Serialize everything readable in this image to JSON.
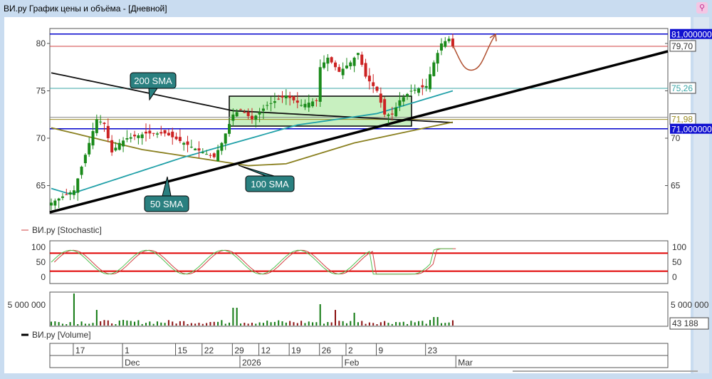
{
  "window": {
    "title": "ВИ.ру График цены и объёма - [Дневной]",
    "pin_icon": "pin-icon"
  },
  "price_panel": {
    "y_ticks": [
      "80",
      "75",
      "70",
      "65"
    ],
    "y_tick_values": [
      80,
      75,
      70,
      65
    ],
    "levels": [
      {
        "label": "81,000000",
        "value": 81,
        "color": "#0000cc",
        "style": "badge"
      },
      {
        "label": "79,70",
        "value": 79.7,
        "color": "#d04040",
        "style": "box"
      },
      {
        "label": "75,26",
        "value": 75.26,
        "color": "#3aa6a6",
        "style": "box"
      },
      {
        "label": "71,98",
        "value": 71.98,
        "color": "#9a8a20",
        "style": "box"
      },
      {
        "label": "71,000000",
        "value": 71,
        "color": "#0000cc",
        "style": "badge"
      }
    ],
    "annotations": [
      "200 SMA",
      "50 SMA",
      "100 SMA"
    ],
    "close_keypoints": [
      [
        0,
        63.2
      ],
      [
        6,
        64.5
      ],
      [
        8,
        67
      ],
      [
        10,
        69.5
      ],
      [
        12,
        72
      ],
      [
        14,
        71.5
      ],
      [
        16,
        68.5
      ],
      [
        18,
        69.5
      ],
      [
        20,
        70
      ],
      [
        25,
        70.5
      ],
      [
        30,
        70.5
      ],
      [
        35,
        69.5
      ],
      [
        40,
        68.5
      ],
      [
        43,
        68
      ],
      [
        45,
        69.5
      ],
      [
        48,
        72.5
      ],
      [
        50,
        73
      ],
      [
        53,
        72
      ],
      [
        57,
        73.5
      ],
      [
        62,
        74.5
      ],
      [
        66,
        73.5
      ],
      [
        70,
        74
      ],
      [
        71,
        77.5
      ],
      [
        73,
        78.5
      ],
      [
        76,
        77
      ],
      [
        79,
        78
      ],
      [
        81,
        79
      ],
      [
        83,
        76.5
      ],
      [
        86,
        75
      ],
      [
        88,
        72.5
      ],
      [
        90,
        72.5
      ],
      [
        92,
        74
      ],
      [
        95,
        75
      ],
      [
        99,
        75.5
      ],
      [
        101,
        78
      ],
      [
        103,
        80
      ],
      [
        105,
        80.5
      ],
      [
        106,
        79.7
      ]
    ],
    "sma200": [
      [
        0,
        76.9
      ],
      [
        48,
        72.9
      ],
      [
        106,
        71.65
      ]
    ],
    "sma50": [
      [
        0,
        64.7
      ],
      [
        5,
        64.1
      ],
      [
        35,
        68
      ],
      [
        65,
        71.4
      ],
      [
        86,
        72.6
      ],
      [
        106,
        75.0
      ]
    ],
    "sma100": [
      [
        0,
        71.1
      ],
      [
        24,
        68.8
      ],
      [
        52,
        67.1
      ],
      [
        62,
        67.3
      ],
      [
        80,
        69.5
      ],
      [
        106,
        71.7
      ]
    ]
  },
  "stochastic": {
    "legend": "ВИ.ру [Stochastic]",
    "ticks": [
      "100",
      "50",
      "0"
    ],
    "levels": [
      80,
      20
    ]
  },
  "volume": {
    "legend": "ВИ.ру [Volume]",
    "tick": "5 000 000",
    "last": "43 188"
  },
  "x_axis": {
    "days": [
      {
        "t": "17",
        "i": 6
      },
      {
        "t": "1",
        "i": 19
      },
      {
        "t": "15",
        "i": 33
      },
      {
        "t": "22",
        "i": 40
      },
      {
        "t": "29",
        "i": 48
      },
      {
        "t": "12",
        "i": 55
      },
      {
        "t": "19",
        "i": 63
      },
      {
        "t": "26",
        "i": 71
      },
      {
        "t": "2",
        "i": 78
      },
      {
        "t": "9",
        "i": 86
      },
      {
        "t": "23",
        "i": 99
      }
    ],
    "months": [
      {
        "t": "Dec",
        "i": 19
      },
      {
        "t": "2026",
        "i": 50
      },
      {
        "t": "Feb",
        "i": 77
      },
      {
        "t": "Mar",
        "i": 107
      }
    ]
  },
  "colors": {
    "up": "#1a8a1a",
    "down": "#cc2222",
    "vol_up": "#127a12",
    "vol_down": "#8a1010"
  }
}
